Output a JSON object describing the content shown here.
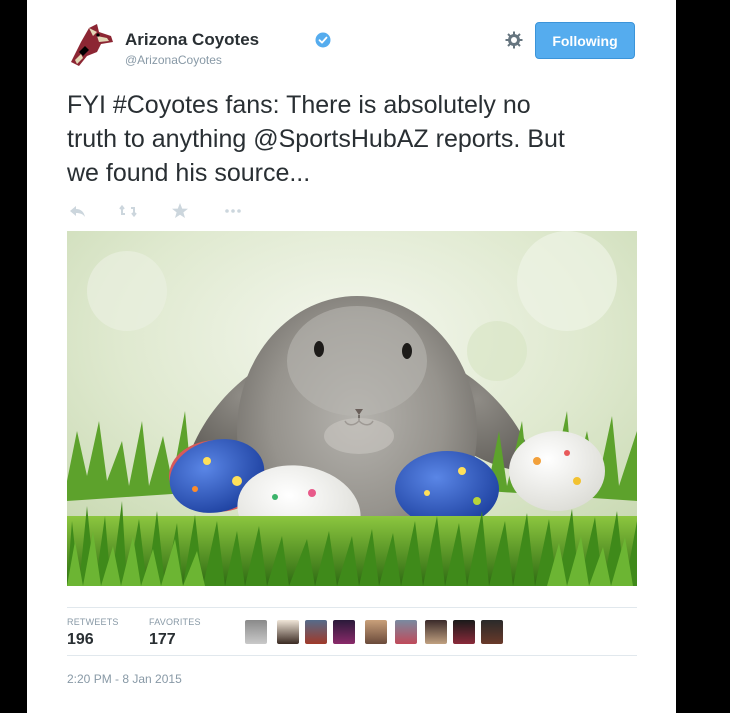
{
  "tweet": {
    "author_name": "Arizona Coyotes",
    "author_handle": "@ArizonaCoyotes",
    "follow_label": "Following",
    "text": "FYI #Coyotes fans: There is absolutely no truth to anything @SportsHubAZ reports. But we found his source...",
    "text_lines": [
      "FYI #Coyotes fans: There is absolutely no",
      "truth to anything @SportsHubAZ reports. But",
      "we found his source..."
    ],
    "timestamp": "2:20 PM - 8 Jan 2015"
  },
  "actions": {
    "icons": [
      "reply-icon",
      "retweet-icon",
      "favorite-icon",
      "more-icon"
    ]
  },
  "stats": {
    "retweets_label": "RETWEETS",
    "retweets_count": "196",
    "favorites_label": "FAVORITES",
    "favorites_count": "177"
  },
  "colors": {
    "follow_button": "#55acee",
    "verified_badge": "#55acee",
    "text": "#292f33",
    "muted": "#8899a6",
    "logo_red": "#8c2633"
  },
  "icons": {
    "verified": "verified-badge-icon",
    "settings": "gear-icon",
    "avatar": "coyote-logo-icon"
  }
}
